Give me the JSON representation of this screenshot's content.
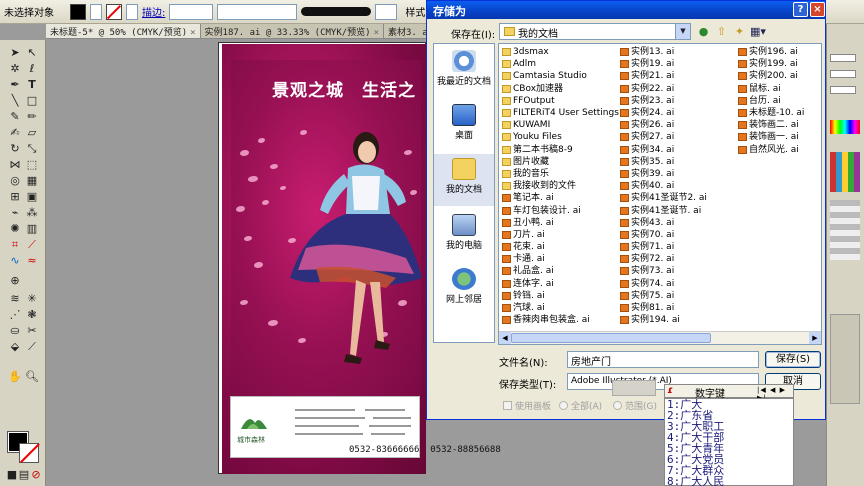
{
  "control_bar": {
    "selection_label": "未选择对象",
    "stroke_label": "描边:",
    "style_label": "样式:"
  },
  "doc_tabs": [
    {
      "label": "未标题-5* @ 50% (CMYK/预览)",
      "active": true
    },
    {
      "label": "实例187. ai @ 33.33% (CMYK/预览)",
      "active": false
    },
    {
      "label": "素材3. ai @ 87%",
      "active": false
    }
  ],
  "poster": {
    "headline_1": "景观之城",
    "headline_2": "生活之",
    "phone_1": "0532-83666666",
    "phone_2": "0532-88856688",
    "logo_text": "城市森林"
  },
  "dialog": {
    "title": "存储为",
    "help_glyph": "?",
    "close_glyph": "×",
    "save_in_label": "保存在(I):",
    "save_in_value": "我的文档",
    "places": [
      "我最近的文档",
      "桌面",
      "我的文档",
      "我的电脑",
      "网上邻居"
    ],
    "files_col1": [
      {
        "name": "3dsmax",
        "type": "folder"
      },
      {
        "name": "Adlm",
        "type": "folder"
      },
      {
        "name": "Camtasia Studio",
        "type": "folder"
      },
      {
        "name": "CBox加速器",
        "type": "folder"
      },
      {
        "name": "FFOutput",
        "type": "folder"
      },
      {
        "name": "FILTERiT4 User Settings",
        "type": "folder"
      },
      {
        "name": "KUWAMI",
        "type": "folder"
      },
      {
        "name": "Youku Files",
        "type": "folder"
      },
      {
        "name": "第二本书稿8-9",
        "type": "folder"
      },
      {
        "name": "图片收藏",
        "type": "folder"
      },
      {
        "name": "我的音乐",
        "type": "folder"
      },
      {
        "name": "我接收到的文件",
        "type": "folder"
      },
      {
        "name": "笔记本. ai",
        "type": "ai"
      },
      {
        "name": "车灯包装设计. ai",
        "type": "ai"
      },
      {
        "name": "丑小鸭. ai",
        "type": "ai"
      },
      {
        "name": "刀片. ai",
        "type": "ai"
      },
      {
        "name": "花束. ai",
        "type": "ai"
      },
      {
        "name": "卡通. ai",
        "type": "ai"
      },
      {
        "name": "礼品盒. ai",
        "type": "ai"
      },
      {
        "name": "连体字. ai",
        "type": "ai"
      },
      {
        "name": "铃铛. ai",
        "type": "ai"
      },
      {
        "name": "汽球. ai",
        "type": "ai"
      },
      {
        "name": "香辣肉串包装盒. ai",
        "type": "ai"
      }
    ],
    "files_col2": [
      {
        "name": "实例13. ai",
        "type": "ai"
      },
      {
        "name": "实例19. ai",
        "type": "ai"
      },
      {
        "name": "实例21. ai",
        "type": "ai"
      },
      {
        "name": "实例22. ai",
        "type": "ai"
      },
      {
        "name": "实例23. ai",
        "type": "ai"
      },
      {
        "name": "实例24. ai",
        "type": "ai"
      },
      {
        "name": "实例26. ai",
        "type": "ai"
      },
      {
        "name": "实例27. ai",
        "type": "ai"
      },
      {
        "name": "实例34. ai",
        "type": "ai"
      },
      {
        "name": "实例35. ai",
        "type": "ai"
      },
      {
        "name": "实例39. ai",
        "type": "ai"
      },
      {
        "name": "实例40. ai",
        "type": "ai"
      },
      {
        "name": "实例41圣诞节2. ai",
        "type": "ai"
      },
      {
        "name": "实例41圣诞节. ai",
        "type": "ai"
      },
      {
        "name": "实例43. ai",
        "type": "ai"
      },
      {
        "name": "实例70. ai",
        "type": "ai"
      },
      {
        "name": "实例71. ai",
        "type": "ai"
      },
      {
        "name": "实例72. ai",
        "type": "ai"
      },
      {
        "name": "实例73. ai",
        "type": "ai"
      },
      {
        "name": "实例74. ai",
        "type": "ai"
      },
      {
        "name": "实例75. ai",
        "type": "ai"
      },
      {
        "name": "实例81. ai",
        "type": "ai"
      },
      {
        "name": "实例194. ai",
        "type": "ai"
      }
    ],
    "files_col3": [
      {
        "name": "实例196. ai",
        "type": "ai"
      },
      {
        "name": "实例199. ai",
        "type": "ai"
      },
      {
        "name": "实例200. ai",
        "type": "ai"
      },
      {
        "name": "鼠标. ai",
        "type": "ai"
      },
      {
        "name": "台历. ai",
        "type": "ai"
      },
      {
        "name": "未标题-10. ai",
        "type": "ai"
      },
      {
        "name": "装饰画二. ai",
        "type": "ai"
      },
      {
        "name": "装饰画一. ai",
        "type": "ai"
      },
      {
        "name": "自然风光. ai",
        "type": "ai"
      }
    ],
    "filename_label": "文件名(N):",
    "filename_value": "房地产门",
    "filetype_label": "保存类型(T):",
    "filetype_value": "Adobe Illustrator (*.AI)",
    "save_button": "保存(S)",
    "cancel_button": "取消",
    "opt_artboards": "使用画板",
    "opt_all": "全部(A)",
    "opt_range": "范围(G)"
  },
  "ime": {
    "title": "数字键",
    "nav_glyphs": "|◀ ◀ ▶ ▶|",
    "candidates": [
      "1:广大",
      "2:广东省",
      "3:广大职工",
      "4:广大干部",
      "5:广大青年",
      "6:广大党员",
      "7:广大群众",
      "8:广大人民"
    ]
  },
  "colors": {
    "dialog_title_bar": "#0842c7",
    "poster_magenta": "#a4145a",
    "petal_pink": "#f6a9cf"
  }
}
